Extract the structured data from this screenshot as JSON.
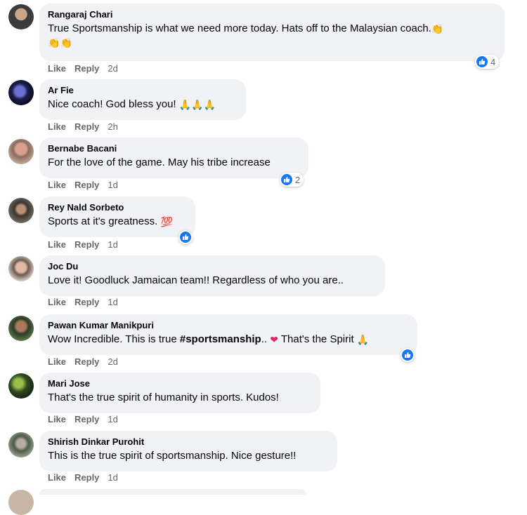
{
  "actions": {
    "like": "Like",
    "reply": "Reply"
  },
  "comments": [
    {
      "author": "Rangaraj Chari",
      "text": "True Sportsmanship is what we need more today. Hats off to the Malaysian coach.",
      "text2": "",
      "time": "2d",
      "reactions": "4"
    },
    {
      "author": "Ar Fie",
      "text": "Nice coach! God bless you!",
      "time": "2h"
    },
    {
      "author": "Bernabe Bacani",
      "text": "For the love of the game. May his tribe increase",
      "time": "1d",
      "reactions": "2"
    },
    {
      "author": "Rey Nald Sorbeto",
      "text": "Sports at it's greatness.",
      "time": "1d"
    },
    {
      "author": "Joc Du",
      "text": "Love it! Goodluck Jamaican team!! Regardless of who you are..",
      "time": "1d"
    },
    {
      "author": "Pawan Kumar Manikpuri",
      "text_a": "Wow Incredible. This is true ",
      "hashtag": "#sportsmanship",
      "text_b": "..",
      "text_c": " That's the Spirit",
      "time": "2d"
    },
    {
      "author": "Mari Jose",
      "text": "That's the true spirit of humanity in sports. Kudos!",
      "time": "1d"
    },
    {
      "author": "Shirish Dinkar Purohit",
      "text": "This is the true spirit of sportsmanship. Nice gesture!!",
      "time": "1d"
    }
  ],
  "colors": {
    "bubble": "#f0f2f5",
    "like_blue": "#1877f2",
    "meta_gray": "#65676b"
  },
  "icons": [
    "like-reaction-icon",
    "clap-emoji-icon",
    "pray-emoji-icon",
    "hundred-emoji-icon",
    "heart-emoji-icon"
  ]
}
